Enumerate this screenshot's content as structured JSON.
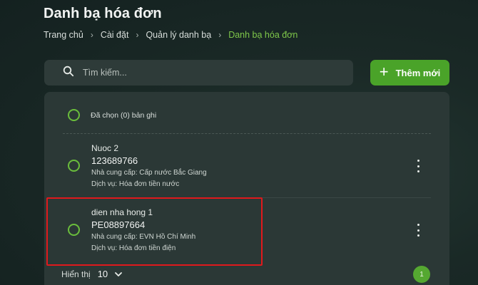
{
  "page": {
    "title": "Danh bạ hóa đơn"
  },
  "breadcrumb": {
    "items": [
      "Trang chủ",
      "Cài đặt",
      "Quản lý danh bạ",
      "Danh bạ hóa đơn"
    ],
    "separator": "›"
  },
  "search": {
    "placeholder": "Tìm kiếm...",
    "value": "",
    "icon": "search-icon"
  },
  "toolbar": {
    "add_label": "Thêm mới",
    "add_icon": "plus-icon"
  },
  "list": {
    "select_all_label": "Đã chọn (0) bản ghi",
    "rows": [
      {
        "name": "Nuoc 2",
        "code": "123689766",
        "provider": "Nhà cung cấp: Cấp nước Bắc Giang",
        "service": "Dịch vụ: Hóa đơn tiền nước"
      },
      {
        "name": "dien nha hong 1",
        "code": "PE08897664",
        "provider": "Nhà cung cấp: EVN Hồ Chí Minh",
        "service": "Dịch vụ: Hóa đơn tiền điện"
      }
    ]
  },
  "pagination": {
    "show_label": "Hiển thị",
    "page_size": "10",
    "current_page": "1"
  },
  "colors": {
    "accent": "#4aa329",
    "highlight": "#e0191c",
    "background": "#1a2926"
  }
}
